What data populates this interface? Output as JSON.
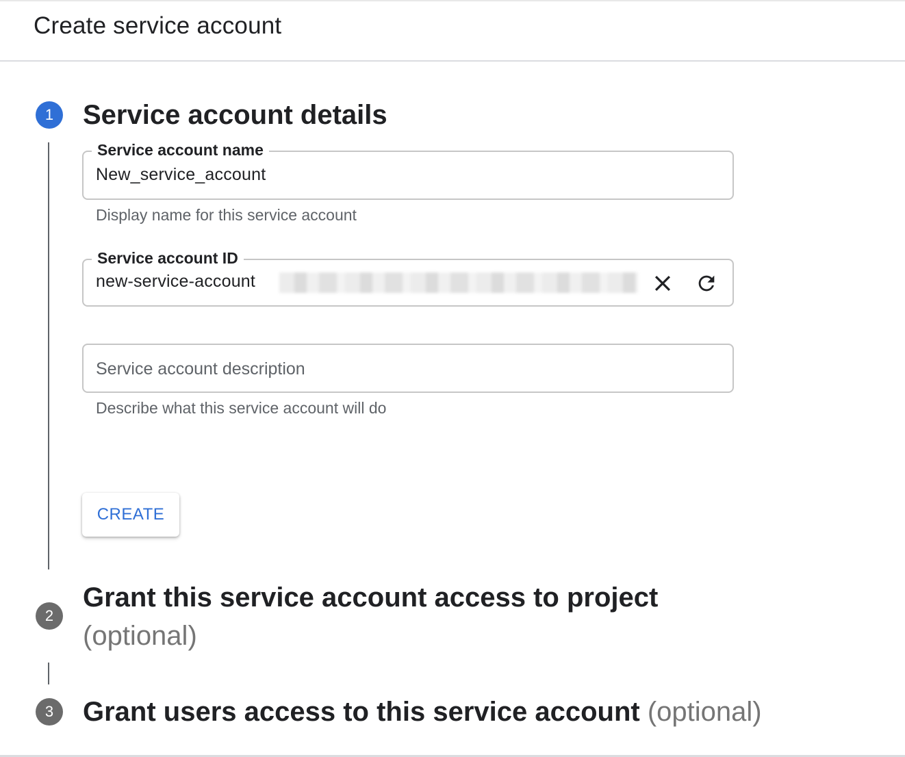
{
  "header": {
    "title": "Create service account"
  },
  "steps": [
    {
      "number": "1",
      "title": "Service account details",
      "optional": "",
      "state": "active"
    },
    {
      "number": "2",
      "title": "Grant this service account access to project",
      "optional": "(optional)",
      "state": "inactive"
    },
    {
      "number": "3",
      "title": "Grant users access to this service account",
      "optional": "(optional)",
      "state": "inactive"
    }
  ],
  "form": {
    "name_field": {
      "label": "Service account name",
      "value": "New_service_account",
      "helper": "Display name for this service account"
    },
    "id_field": {
      "label": "Service account ID",
      "value": "new-service-account",
      "clear_icon": "close-icon",
      "refresh_icon": "refresh-icon"
    },
    "description_field": {
      "placeholder": "Service account description",
      "helper": "Describe what this service account will do"
    },
    "create_label": "CREATE"
  },
  "colors": {
    "accent": "#2f6fd6",
    "inactive_step": "#6b6b6b",
    "optional_text": "#757575",
    "border": "#c6c6c6"
  }
}
